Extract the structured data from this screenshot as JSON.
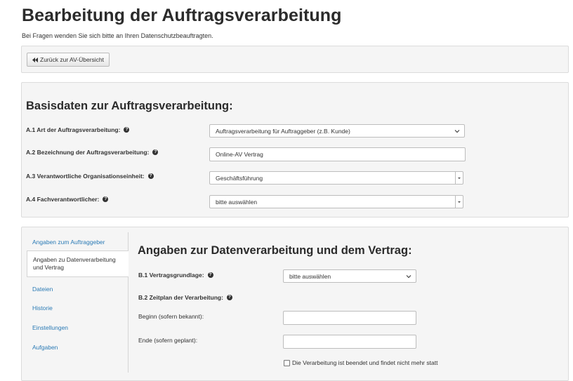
{
  "page": {
    "title": "Bearbeitung der Auftragsverarbeitung",
    "subtitle": "Bei Fragen wenden Sie sich bitte an Ihren Datenschutzbeauftragten."
  },
  "toolbar": {
    "back_label": "Zurück zur AV-Übersicht",
    "back_icon": "double-arrow-left-icon"
  },
  "basisdaten": {
    "heading": "Basisdaten zur Auftragsverarbeitung:",
    "fields": [
      {
        "label": "A.1 Art der Auftragsverarbeitung:",
        "value": "Auftragsverarbeitung für Auftraggeber (z.B. Kunde)",
        "type": "select"
      },
      {
        "label": "A.2 Bezeichnung der Auftragsverarbeitung:",
        "value": "Online-AV Vertrag",
        "type": "text"
      },
      {
        "label": "A.3 Verantwortliche Organisationseinheit:",
        "value": "Geschäftsführung",
        "type": "select"
      },
      {
        "label": "A.4 Fachverantwortlicher:",
        "value": "bitte auswählen",
        "type": "select"
      }
    ]
  },
  "sidebar": {
    "items": [
      {
        "label": "Angaben zum Auftraggeber",
        "active": false
      },
      {
        "label": "Angaben zu Datenverarbeitung und Vertrag",
        "line1": "Angaben zu Datenverarbeitung",
        "line2": "und Vertrag",
        "active": true
      },
      {
        "label": "Dateien",
        "active": false
      },
      {
        "label": "Historie",
        "active": false
      },
      {
        "label": "Einstellungen",
        "active": false
      },
      {
        "label": "Aufgaben",
        "active": false
      }
    ]
  },
  "datenverarbeitung": {
    "heading": "Angaben zur Datenverarbeitung und dem Vertrag:",
    "b1_label": "B.1 Vertragsgrundlage:",
    "b1_value": "bitte auswählen",
    "b2_label": "B.2 Zeitplan der Verarbeitung:",
    "beginn_label": "Beginn (sofern bekannt):",
    "beginn_value": "",
    "ende_label": "Ende (sofern geplant):",
    "ende_value": "",
    "checkbox_label": "Die Verarbeitung ist beendet und findet nicht mehr statt",
    "checkbox_checked": false
  },
  "colors": {
    "link": "#2a7ab5",
    "panel_bg": "#f5f5f5",
    "title": "#2b2b2b"
  }
}
